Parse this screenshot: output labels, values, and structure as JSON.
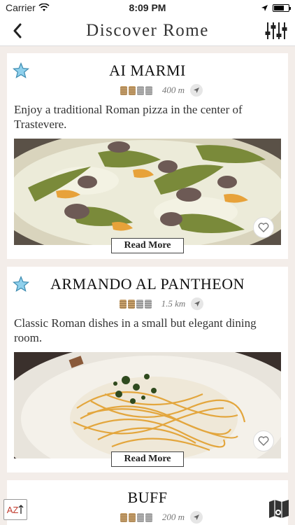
{
  "status": {
    "carrier": "Carrier",
    "time": "8:09 PM"
  },
  "header": {
    "title": "Discover Rome"
  },
  "restaurants": [
    {
      "name": "AI MARMI",
      "price_level": 2,
      "distance": "400 m",
      "description": "Enjoy a traditional Roman pizza in the center of Trastevere.",
      "read_more": "Read More"
    },
    {
      "name": "ARMANDO AL PANTHEON",
      "price_level": 2,
      "distance": "1.5 km",
      "description": "Classic Roman dishes in a small but elegant dining room.",
      "read_more": "Read More"
    },
    {
      "name": "BUFF",
      "price_level": 2,
      "distance": "200 m"
    }
  ],
  "bottom": {
    "sort_label": "AZ"
  },
  "colors": {
    "accent_star": "#6fb6d6",
    "coin_gold": "#b8925f"
  }
}
